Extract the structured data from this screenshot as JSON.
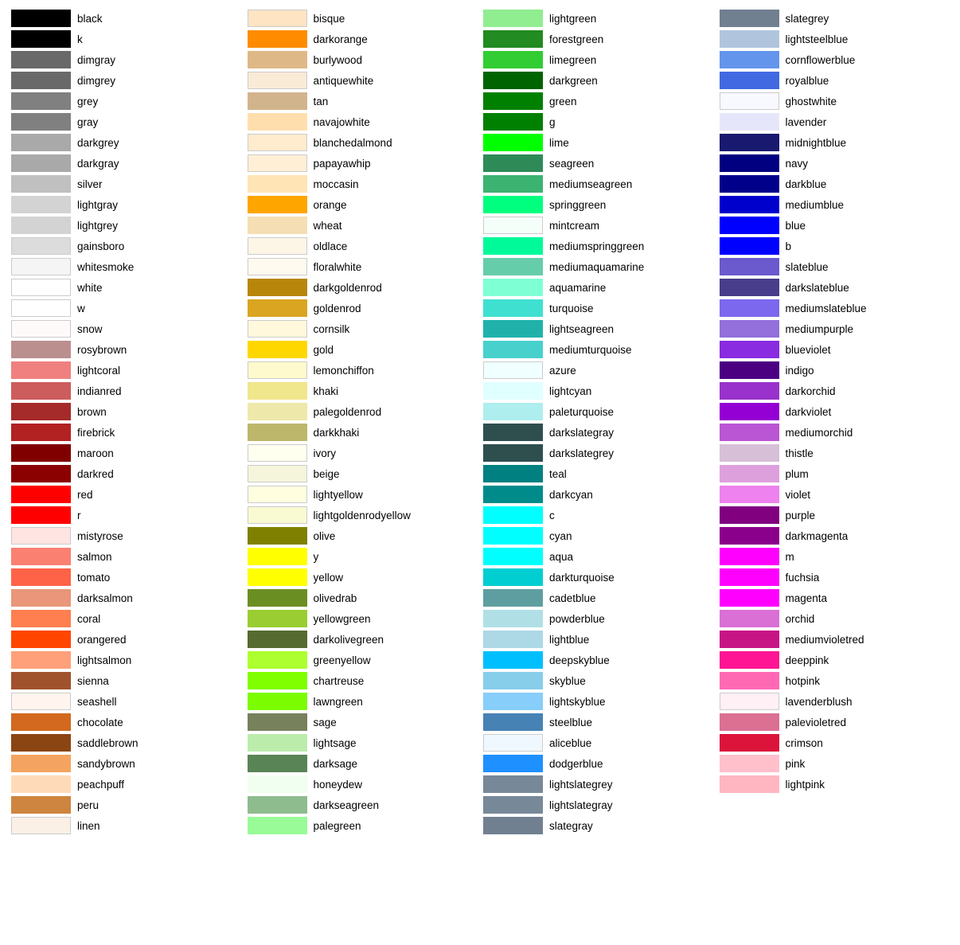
{
  "columns": [
    {
      "items": [
        {
          "name": "black",
          "color": "#000000"
        },
        {
          "name": "k",
          "color": "#000000"
        },
        {
          "name": "dimgray",
          "color": "#696969"
        },
        {
          "name": "dimgrey",
          "color": "#696969"
        },
        {
          "name": "grey",
          "color": "#808080"
        },
        {
          "name": "gray",
          "color": "#808080"
        },
        {
          "name": "darkgrey",
          "color": "#A9A9A9"
        },
        {
          "name": "darkgray",
          "color": "#A9A9A9"
        },
        {
          "name": "silver",
          "color": "#C0C0C0"
        },
        {
          "name": "lightgray",
          "color": "#D3D3D3"
        },
        {
          "name": "lightgrey",
          "color": "#D3D3D3"
        },
        {
          "name": "gainsboro",
          "color": "#DCDCDC"
        },
        {
          "name": "whitesmoke",
          "color": "#F5F5F5"
        },
        {
          "name": "white",
          "color": "#FFFFFF"
        },
        {
          "name": "w",
          "color": "#FFFFFF"
        },
        {
          "name": "snow",
          "color": "#FFFAFA"
        },
        {
          "name": "rosybrown",
          "color": "#BC8F8F"
        },
        {
          "name": "lightcoral",
          "color": "#F08080"
        },
        {
          "name": "indianred",
          "color": "#CD5C5C"
        },
        {
          "name": "brown",
          "color": "#A52A2A"
        },
        {
          "name": "firebrick",
          "color": "#B22222"
        },
        {
          "name": "maroon",
          "color": "#800000"
        },
        {
          "name": "darkred",
          "color": "#8B0000"
        },
        {
          "name": "red",
          "color": "#FF0000"
        },
        {
          "name": "r",
          "color": "#FF0000"
        },
        {
          "name": "mistyrose",
          "color": "#FFE4E1"
        },
        {
          "name": "salmon",
          "color": "#FA8072"
        },
        {
          "name": "tomato",
          "color": "#FF6347"
        },
        {
          "name": "darksalmon",
          "color": "#E9967A"
        },
        {
          "name": "coral",
          "color": "#FF7F50"
        },
        {
          "name": "orangered",
          "color": "#FF4500"
        },
        {
          "name": "lightsalmon",
          "color": "#FFA07A"
        },
        {
          "name": "sienna",
          "color": "#A0522D"
        },
        {
          "name": "seashell",
          "color": "#FFF5EE"
        },
        {
          "name": "chocolate",
          "color": "#D2691E"
        },
        {
          "name": "saddlebrown",
          "color": "#8B4513"
        },
        {
          "name": "sandybrown",
          "color": "#F4A460"
        },
        {
          "name": "peachpuff",
          "color": "#FFDAB9"
        },
        {
          "name": "peru",
          "color": "#CD853F"
        },
        {
          "name": "linen",
          "color": "#FAF0E6"
        }
      ]
    },
    {
      "items": [
        {
          "name": "bisque",
          "color": "#FFE4C4"
        },
        {
          "name": "darkorange",
          "color": "#FF8C00"
        },
        {
          "name": "burlywood",
          "color": "#DEB887"
        },
        {
          "name": "antiquewhite",
          "color": "#FAEBD7"
        },
        {
          "name": "tan",
          "color": "#D2B48C"
        },
        {
          "name": "navajowhite",
          "color": "#FFDEAD"
        },
        {
          "name": "blanchedalmond",
          "color": "#FFEBCD"
        },
        {
          "name": "papayawhip",
          "color": "#FFEFD5"
        },
        {
          "name": "moccasin",
          "color": "#FFE4B5"
        },
        {
          "name": "orange",
          "color": "#FFA500"
        },
        {
          "name": "wheat",
          "color": "#F5DEB3"
        },
        {
          "name": "oldlace",
          "color": "#FDF5E6"
        },
        {
          "name": "floralwhite",
          "color": "#FFFAF0"
        },
        {
          "name": "darkgoldenrod",
          "color": "#B8860B"
        },
        {
          "name": "goldenrod",
          "color": "#DAA520"
        },
        {
          "name": "cornsilk",
          "color": "#FFF8DC"
        },
        {
          "name": "gold",
          "color": "#FFD700"
        },
        {
          "name": "lemonchiffon",
          "color": "#FFFACD"
        },
        {
          "name": "khaki",
          "color": "#F0E68C"
        },
        {
          "name": "palegoldenrod",
          "color": "#EEE8AA"
        },
        {
          "name": "darkkhaki",
          "color": "#BDB76B"
        },
        {
          "name": "ivory",
          "color": "#FFFFF0"
        },
        {
          "name": "beige",
          "color": "#F5F5DC"
        },
        {
          "name": "lightyellow",
          "color": "#FFFFE0"
        },
        {
          "name": "lightgoldenrodyellow",
          "color": "#FAFAD2"
        },
        {
          "name": "olive",
          "color": "#808000"
        },
        {
          "name": "y",
          "color": "#FFFF00"
        },
        {
          "name": "yellow",
          "color": "#FFFF00"
        },
        {
          "name": "olivedrab",
          "color": "#6B8E23"
        },
        {
          "name": "yellowgreen",
          "color": "#9ACD32"
        },
        {
          "name": "darkolivegreen",
          "color": "#556B2F"
        },
        {
          "name": "greenyellow",
          "color": "#ADFF2F"
        },
        {
          "name": "chartreuse",
          "color": "#7FFF00"
        },
        {
          "name": "lawngreen",
          "color": "#7CFC00"
        },
        {
          "name": "sage",
          "color": "#77815C"
        },
        {
          "name": "lightsage",
          "color": "#BCECAC"
        },
        {
          "name": "darksage",
          "color": "#598556"
        },
        {
          "name": "honeydew",
          "color": "#F0FFF0"
        },
        {
          "name": "darkseagreen",
          "color": "#8FBC8F"
        },
        {
          "name": "palegreen",
          "color": "#98FB98"
        }
      ]
    },
    {
      "items": [
        {
          "name": "lightgreen",
          "color": "#90EE90"
        },
        {
          "name": "forestgreen",
          "color": "#228B22"
        },
        {
          "name": "limegreen",
          "color": "#32CD32"
        },
        {
          "name": "darkgreen",
          "color": "#006400"
        },
        {
          "name": "green",
          "color": "#008000"
        },
        {
          "name": "g",
          "color": "#008000"
        },
        {
          "name": "lime",
          "color": "#00FF00"
        },
        {
          "name": "seagreen",
          "color": "#2E8B57"
        },
        {
          "name": "mediumseagreen",
          "color": "#3CB371"
        },
        {
          "name": "springgreen",
          "color": "#00FF7F"
        },
        {
          "name": "mintcream",
          "color": "#F5FFFA"
        },
        {
          "name": "mediumspringgreen",
          "color": "#00FA9A"
        },
        {
          "name": "mediumaquamarine",
          "color": "#66CDAA"
        },
        {
          "name": "aquamarine",
          "color": "#7FFFD4"
        },
        {
          "name": "turquoise",
          "color": "#40E0D0"
        },
        {
          "name": "lightseagreen",
          "color": "#20B2AA"
        },
        {
          "name": "mediumturquoise",
          "color": "#48D1CC"
        },
        {
          "name": "azure",
          "color": "#F0FFFF"
        },
        {
          "name": "lightcyan",
          "color": "#E0FFFF"
        },
        {
          "name": "paleturquoise",
          "color": "#AFEEEE"
        },
        {
          "name": "darkslategray",
          "color": "#2F4F4F"
        },
        {
          "name": "darkslategrey",
          "color": "#2F4F4F"
        },
        {
          "name": "teal",
          "color": "#008080"
        },
        {
          "name": "darkcyan",
          "color": "#008B8B"
        },
        {
          "name": "c",
          "color": "#00FFFF"
        },
        {
          "name": "cyan",
          "color": "#00FFFF"
        },
        {
          "name": "aqua",
          "color": "#00FFFF"
        },
        {
          "name": "darkturquoise",
          "color": "#00CED1"
        },
        {
          "name": "cadetblue",
          "color": "#5F9EA0"
        },
        {
          "name": "powderblue",
          "color": "#B0E0E6"
        },
        {
          "name": "lightblue",
          "color": "#ADD8E6"
        },
        {
          "name": "deepskyblue",
          "color": "#00BFFF"
        },
        {
          "name": "skyblue",
          "color": "#87CEEB"
        },
        {
          "name": "lightskyblue",
          "color": "#87CEFA"
        },
        {
          "name": "steelblue",
          "color": "#4682B4"
        },
        {
          "name": "aliceblue",
          "color": "#F0F8FF"
        },
        {
          "name": "dodgerblue",
          "color": "#1E90FF"
        },
        {
          "name": "lightslategrey",
          "color": "#778899"
        },
        {
          "name": "lightslategray",
          "color": "#778899"
        },
        {
          "name": "slategray",
          "color": "#708090"
        }
      ]
    },
    {
      "items": [
        {
          "name": "slategrey",
          "color": "#708090"
        },
        {
          "name": "lightsteelblue",
          "color": "#B0C4DE"
        },
        {
          "name": "cornflowerblue",
          "color": "#6495ED"
        },
        {
          "name": "royalblue",
          "color": "#4169E1"
        },
        {
          "name": "ghostwhite",
          "color": "#F8F8FF"
        },
        {
          "name": "lavender",
          "color": "#E6E6FA"
        },
        {
          "name": "midnightblue",
          "color": "#191970"
        },
        {
          "name": "navy",
          "color": "#000080"
        },
        {
          "name": "darkblue",
          "color": "#00008B"
        },
        {
          "name": "mediumblue",
          "color": "#0000CD"
        },
        {
          "name": "blue",
          "color": "#0000FF"
        },
        {
          "name": "b",
          "color": "#0000FF"
        },
        {
          "name": "slateblue",
          "color": "#6A5ACD"
        },
        {
          "name": "darkslateblue",
          "color": "#483D8B"
        },
        {
          "name": "mediumslateblue",
          "color": "#7B68EE"
        },
        {
          "name": "mediumpurple",
          "color": "#9370DB"
        },
        {
          "name": "blueviolet",
          "color": "#8A2BE2"
        },
        {
          "name": "indigo",
          "color": "#4B0082"
        },
        {
          "name": "darkorchid",
          "color": "#9932CC"
        },
        {
          "name": "darkviolet",
          "color": "#9400D3"
        },
        {
          "name": "mediumorchid",
          "color": "#BA55D3"
        },
        {
          "name": "thistle",
          "color": "#D8BFD8"
        },
        {
          "name": "plum",
          "color": "#DDA0DD"
        },
        {
          "name": "violet",
          "color": "#EE82EE"
        },
        {
          "name": "purple",
          "color": "#800080"
        },
        {
          "name": "darkmagenta",
          "color": "#8B008B"
        },
        {
          "name": "m",
          "color": "#FF00FF"
        },
        {
          "name": "fuchsia",
          "color": "#FF00FF"
        },
        {
          "name": "magenta",
          "color": "#FF00FF"
        },
        {
          "name": "orchid",
          "color": "#DA70D6"
        },
        {
          "name": "mediumvioletred",
          "color": "#C71585"
        },
        {
          "name": "deeppink",
          "color": "#FF1493"
        },
        {
          "name": "hotpink",
          "color": "#FF69B4"
        },
        {
          "name": "lavenderblush",
          "color": "#FFF0F5"
        },
        {
          "name": "palevioletred",
          "color": "#DB7093"
        },
        {
          "name": "crimson",
          "color": "#DC143C"
        },
        {
          "name": "pink",
          "color": "#FFC0CB"
        },
        {
          "name": "lightpink",
          "color": "#FFB6C1"
        },
        {
          "name": "",
          "color": ""
        },
        {
          "name": "",
          "color": ""
        }
      ]
    }
  ]
}
